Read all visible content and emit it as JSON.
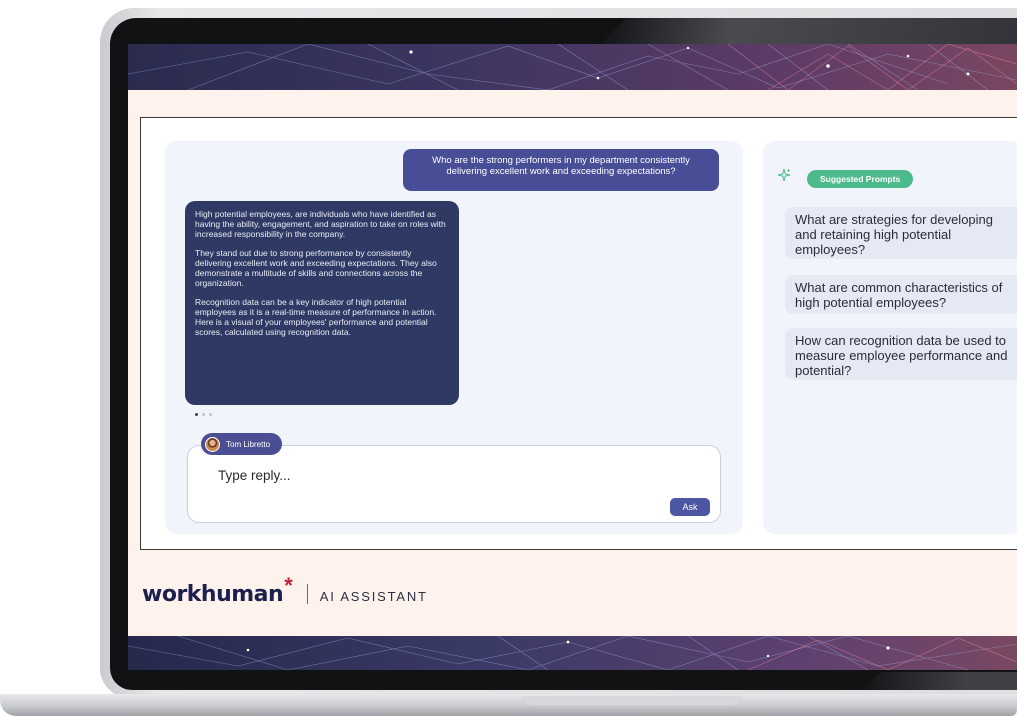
{
  "chat": {
    "user_message": "Who are the strong performers in my department consistently delivering excellent work and exceeding expectations?",
    "ai_response": {
      "paragraph_1": "High potential employees, are individuals who have identified as having the ability, engagement, and aspiration to take on roles with increased responsibility in the company.",
      "paragraph_2": "They stand out due to strong performance by consistently delivering excellent work and exceeding expectations. They also demonstrate a multitude of skills and connections across the organization.",
      "paragraph_3": "Recognition data can be a key indicator of high potential employees as it is a real-time measure of performance in action. Here is a visual of your employees' performance and potential scores, calculated using recognition data."
    },
    "pagination": {
      "total": 3,
      "active": 1
    },
    "reply": {
      "user_name": "Tom Libretto",
      "placeholder": "Type reply...",
      "ask_label": "Ask"
    }
  },
  "suggestions": {
    "badge_label": "Suggested Prompts",
    "icon": "sparkle-icon",
    "prompts": [
      "What are strategies for developing and retaining high potential employees?",
      "What are common characteristics of high potential employees?",
      "How can recognition data be used to measure employee performance and potential?"
    ]
  },
  "footer": {
    "logo": "workhuman",
    "subtitle": "AI ASSISTANT"
  },
  "colors": {
    "accent": "#474e96",
    "ai_bubble": "#2f3a64",
    "suggest_badge": "#4dba8c",
    "logo_star": "#c1233b",
    "screen_bg": "#fdf3ec"
  }
}
